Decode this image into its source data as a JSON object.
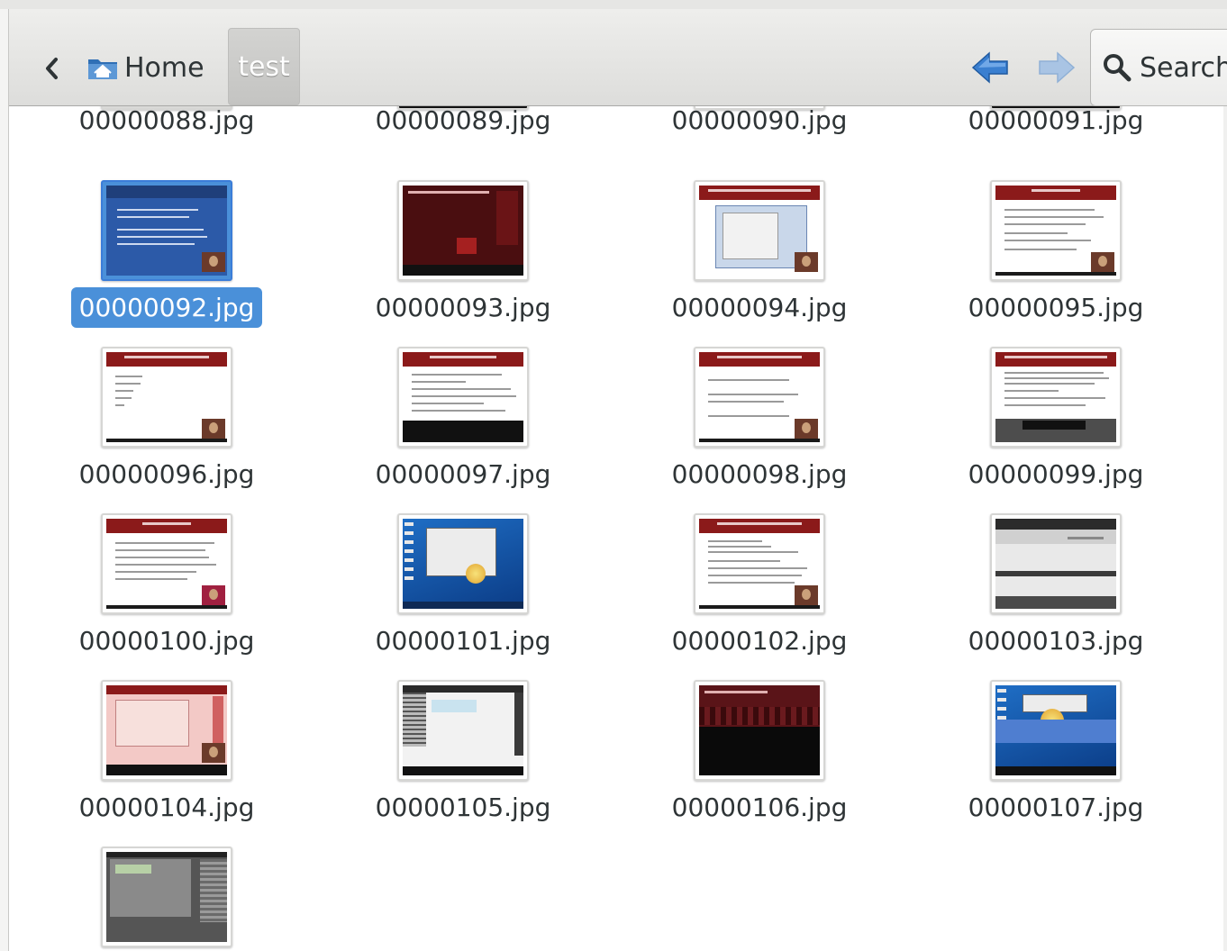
{
  "toolbar": {
    "home_label": "Home",
    "current_folder": "test",
    "search_label": "Search"
  },
  "icons": {
    "back": "chevron-left-icon",
    "home": "home-folder-icon",
    "nav_back": "arrow-left-icon",
    "nav_forward": "arrow-right-icon",
    "search": "magnifier-icon"
  },
  "colors": {
    "selection": "#4a90d9",
    "arrow_active": "#3a7fd0",
    "arrow_inactive": "#a9c4e4",
    "slide_red": "#8b1a1a"
  },
  "files": [
    {
      "name": "00000088.jpg"
    },
    {
      "name": "00000089.jpg"
    },
    {
      "name": "00000090.jpg"
    },
    {
      "name": "00000091.jpg"
    },
    {
      "name": "00000092.jpg",
      "selected": true
    },
    {
      "name": "00000093.jpg"
    },
    {
      "name": "00000094.jpg"
    },
    {
      "name": "00000095.jpg"
    },
    {
      "name": "00000096.jpg"
    },
    {
      "name": "00000097.jpg"
    },
    {
      "name": "00000098.jpg"
    },
    {
      "name": "00000099.jpg"
    },
    {
      "name": "00000100.jpg"
    },
    {
      "name": "00000101.jpg"
    },
    {
      "name": "00000102.jpg"
    },
    {
      "name": "00000103.jpg"
    },
    {
      "name": "00000104.jpg"
    },
    {
      "name": "00000105.jpg"
    },
    {
      "name": "00000106.jpg"
    },
    {
      "name": "00000107.jpg"
    },
    {
      "name": ""
    }
  ]
}
